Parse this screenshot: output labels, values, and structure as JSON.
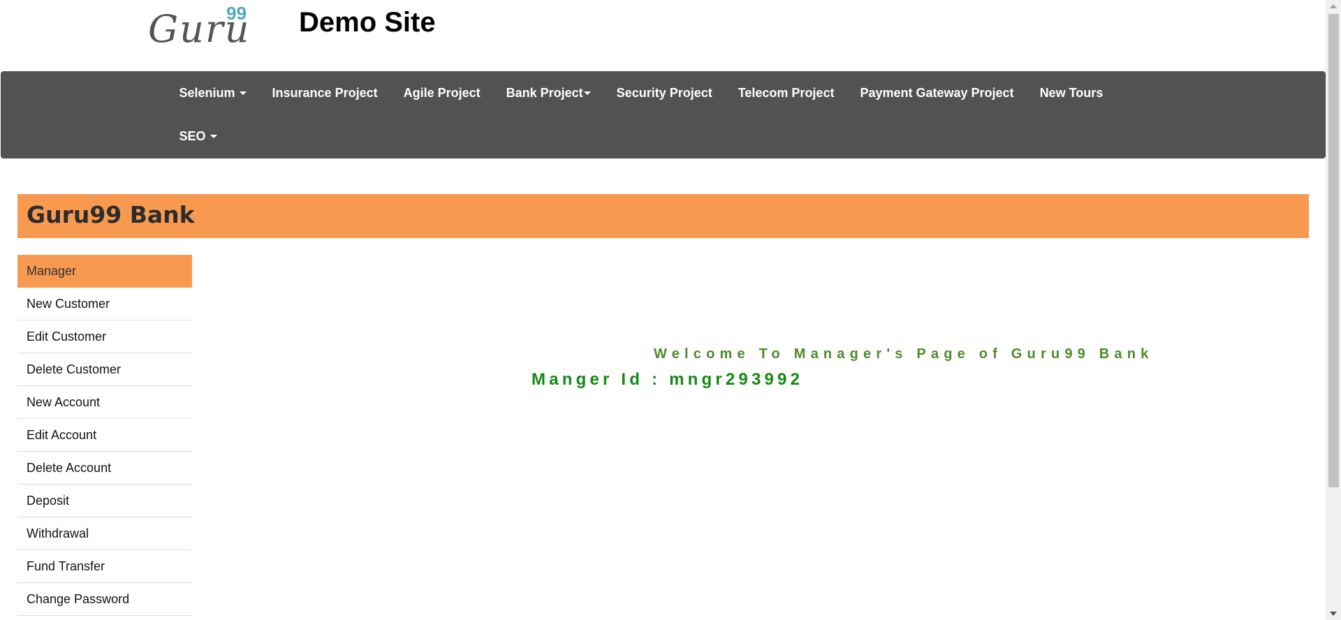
{
  "header": {
    "logo_text": "Guru",
    "logo_sup": "99",
    "site_title": "Demo Site"
  },
  "navbar": {
    "row1": [
      {
        "label": "Selenium",
        "dropdown": true
      },
      {
        "label": "Insurance Project",
        "dropdown": false
      },
      {
        "label": "Agile Project",
        "dropdown": false
      },
      {
        "label": "Bank Project",
        "dropdown": true
      },
      {
        "label": "Security Project",
        "dropdown": false
      },
      {
        "label": "Telecom Project",
        "dropdown": false
      },
      {
        "label": "Payment Gateway Project",
        "dropdown": false
      },
      {
        "label": "New Tours",
        "dropdown": false
      }
    ],
    "row2": [
      {
        "label": "SEO",
        "dropdown": true
      }
    ]
  },
  "bank": {
    "title": "Guru99 Bank"
  },
  "sidebar": {
    "items": [
      {
        "label": "Manager",
        "active": true
      },
      {
        "label": "New Customer"
      },
      {
        "label": "Edit Customer"
      },
      {
        "label": "Delete Customer"
      },
      {
        "label": "New Account"
      },
      {
        "label": "Edit Account"
      },
      {
        "label": "Delete Account"
      },
      {
        "label": "Deposit"
      },
      {
        "label": "Withdrawal"
      },
      {
        "label": "Fund Transfer"
      },
      {
        "label": "Change Password"
      }
    ]
  },
  "main": {
    "welcome": "Welcome To Manager's Page of Guru99 Bank",
    "manager_id": "Manger Id : mngr293992"
  },
  "colors": {
    "navbar_bg": "#525252",
    "accent_orange": "#f79a50",
    "welcome_green": "#4d8a2a",
    "id_green": "#138a13",
    "logo_teal": "#4fa9b8"
  }
}
